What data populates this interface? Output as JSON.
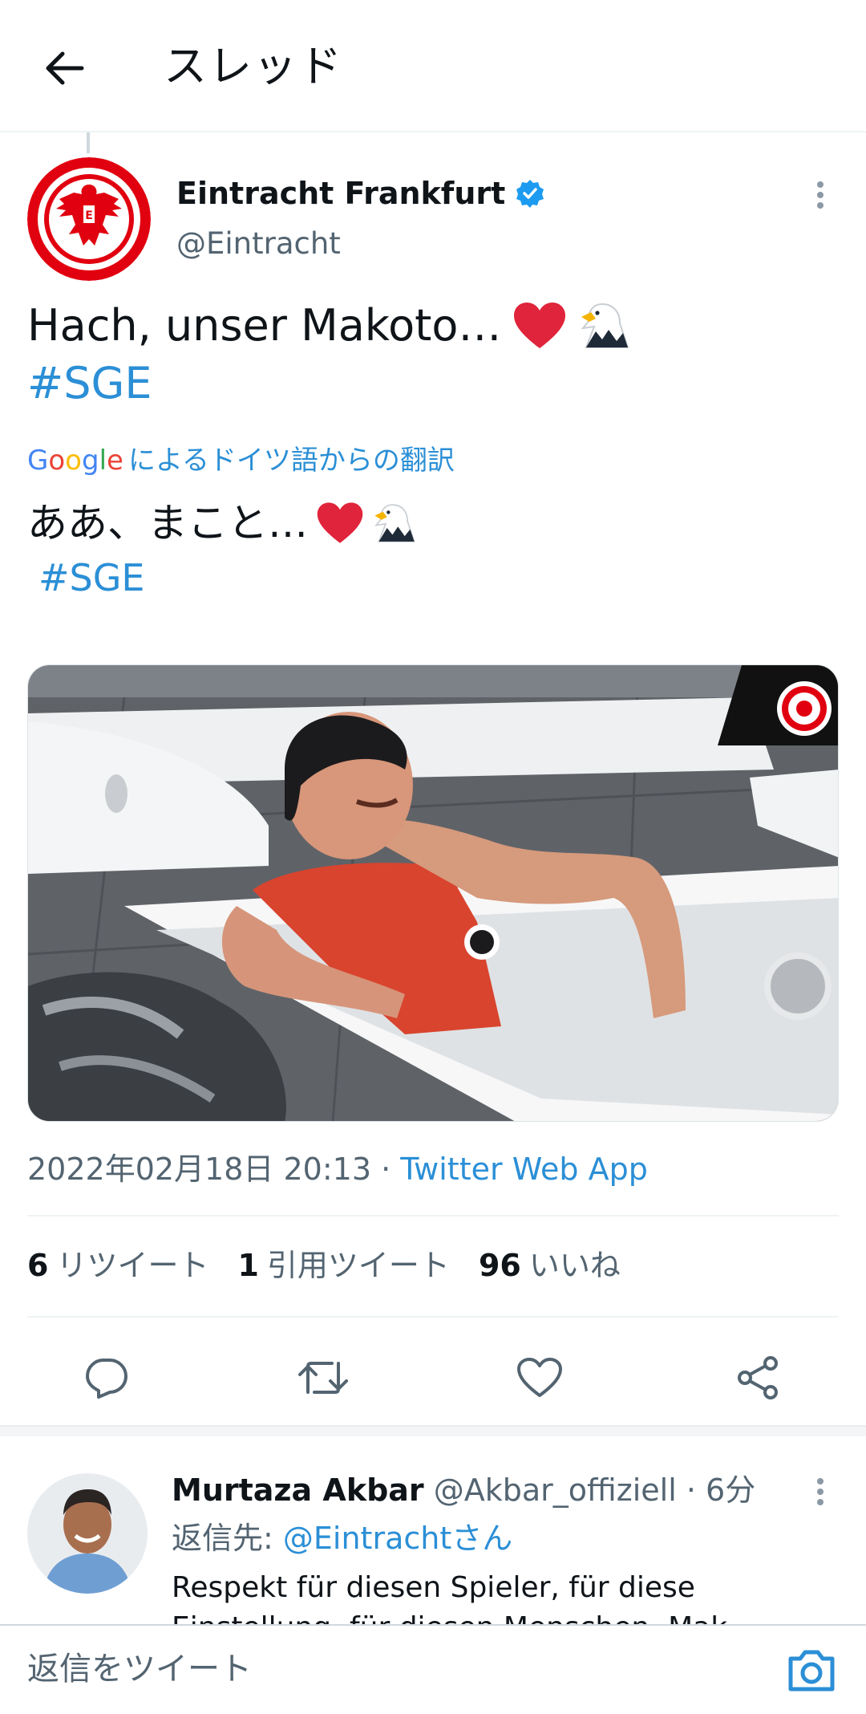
{
  "header": {
    "title": "スレッド",
    "back_icon": "arrow-left-icon"
  },
  "tweet": {
    "author_name": "Eintracht Frankfurt",
    "author_handle": "@Eintracht",
    "verified": true,
    "text_line1": "Hach, unser Makoto… ",
    "emoji": [
      "red-heart",
      "eagle"
    ],
    "hashtag": "#SGE",
    "translation_provider": "Google",
    "translation_label": "によるドイツ語からの翻訳",
    "translated_line1": "ああ、まこと… ",
    "translated_hashtag": "#SGE",
    "timestamp": "2022年02月18日 20:13 · ",
    "source_app": "Twitter Web App",
    "stats": {
      "retweets_count": "6",
      "retweets_label": "リツイート",
      "quotes_count": "1",
      "quotes_label": "引用ツイート",
      "likes_count": "96",
      "likes_label": "いいね"
    },
    "actions": [
      "reply-icon",
      "retweet-icon",
      "like-icon",
      "share-icon"
    ]
  },
  "reply": {
    "author_name": "Murtaza Akbar",
    "author_handle": "@Akbar_offiziell",
    "time": " · 6分",
    "reply_to_prefix": "返信先: ",
    "reply_to_mention": "@Eintrachtさん",
    "text": "Respekt für diesen Spieler, für diese Einstellung, für diesen Menschen. Mak"
  },
  "composer": {
    "placeholder": "返信をツイート",
    "camera_icon": "camera-icon"
  },
  "colors": {
    "link": "#2b8fd6",
    "verified": "#1d9bf0",
    "text": "#0f1419",
    "secondary": "#536471",
    "brand_red": "#e1000f"
  }
}
